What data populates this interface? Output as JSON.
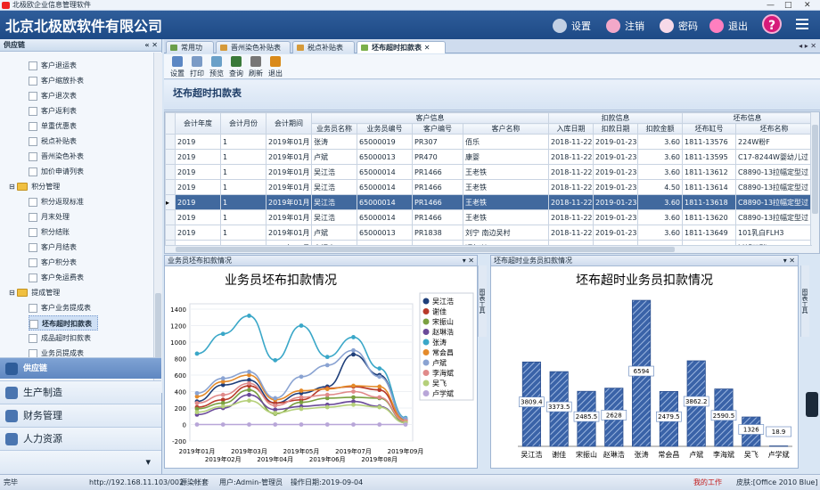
{
  "window": {
    "title": "北极欧企业信息管理软件",
    "controls": [
      "—",
      "□",
      "✕"
    ]
  },
  "header": {
    "app_title": "北京北极欧软件有限公司",
    "buttons": [
      {
        "label": "设置",
        "color": "#c2d0e4"
      },
      {
        "label": "注销",
        "color": "#f3a8c9"
      },
      {
        "label": "密码",
        "color": "#f7d9e8"
      },
      {
        "label": "退出",
        "color": "#ff7fbf"
      }
    ],
    "help": "?"
  },
  "sidebar": {
    "title": "供应链",
    "pin": "« ✕",
    "tree": [
      {
        "label": "客户退运表",
        "type": "leaf",
        "level": 2
      },
      {
        "label": "客户缩放扑表",
        "type": "leaf",
        "level": 2
      },
      {
        "label": "客户退次表",
        "type": "leaf",
        "level": 2
      },
      {
        "label": "客户返利表",
        "type": "leaf",
        "level": 2
      },
      {
        "label": "单重优惠表",
        "type": "leaf",
        "level": 2
      },
      {
        "label": "税点补贴表",
        "type": "leaf",
        "level": 2
      },
      {
        "label": "晋州染色补表",
        "type": "leaf",
        "level": 2
      },
      {
        "label": "加价申请列表",
        "type": "leaf",
        "level": 2
      },
      {
        "label": "积分管理",
        "type": "folder",
        "level": 1
      },
      {
        "label": "积分返现标准",
        "type": "leaf",
        "level": 2
      },
      {
        "label": "月末处理",
        "type": "leaf",
        "level": 2
      },
      {
        "label": "积分结账",
        "type": "leaf",
        "level": 2
      },
      {
        "label": "客户月结表",
        "type": "leaf",
        "level": 2
      },
      {
        "label": "客户积分表",
        "type": "leaf",
        "level": 2
      },
      {
        "label": "客户免运费表",
        "type": "leaf",
        "level": 2
      },
      {
        "label": "提成管理",
        "type": "folder",
        "level": 1
      },
      {
        "label": "客户业务提成表",
        "type": "leaf",
        "level": 2
      },
      {
        "label": "坯布超时扣款表",
        "type": "leaf",
        "level": 2,
        "selected": true
      },
      {
        "label": "成品超时扣款表",
        "type": "leaf",
        "level": 2
      },
      {
        "label": "业务员提成表",
        "type": "leaf",
        "level": 2
      }
    ],
    "groups": [
      {
        "label": "供应链",
        "active": true
      },
      {
        "label": "生产制造"
      },
      {
        "label": "财务管理"
      },
      {
        "label": "人力资源"
      }
    ],
    "more": "▾"
  },
  "tabs": [
    {
      "label": "常用功能"
    },
    {
      "label": "晋州染色补贴表"
    },
    {
      "label": "税点补贴表"
    },
    {
      "label": "坯布超时扣款表",
      "active": true,
      "close": "✕"
    }
  ],
  "tab_nav": "◂ ▸ ✕",
  "toolbar": [
    {
      "label": "设置",
      "color": "#5b87c4"
    },
    {
      "label": "打印",
      "color": "#7b9bc6"
    },
    {
      "label": "预览",
      "color": "#6aa0c8"
    },
    {
      "label": "查询",
      "color": "#3a7a3a"
    },
    {
      "label": "刷新",
      "color": "#777777"
    },
    {
      "label": "退出",
      "color": "#d98a1a"
    }
  ],
  "form_title": "坯布超时扣款表",
  "grid": {
    "group_headers": [
      "客户信息",
      "扣款信息",
      "坯布信息"
    ],
    "columns": [
      "会计年度",
      "会计月份",
      "会计期间",
      "业务员名称",
      "业务员编号",
      "客户编号",
      "客户名称",
      "入库日期",
      "扣款日期",
      "扣款金额",
      "坯布缸号",
      "坯布名称"
    ],
    "rows": [
      [
        "2019",
        "1",
        "2019年01月",
        "张涛",
        "65000019",
        "PR307",
        "佰乐",
        "2018-11-22",
        "2019-01-23",
        "3.60",
        "1811-13576",
        "224W粉F"
      ],
      [
        "2019",
        "1",
        "2019年01月",
        "卢斌",
        "65000013",
        "PR470",
        "康婴",
        "2018-11-22",
        "2019-01-23",
        "3.60",
        "1811-13595",
        "C17-8244W婴幼儿过"
      ],
      [
        "2019",
        "1",
        "2019年01月",
        "吴江浩",
        "65000014",
        "PR1466",
        "王老铁",
        "2018-11-22",
        "2019-01-23",
        "3.60",
        "1811-13612",
        "C8890-13拉幅定型过"
      ],
      [
        "2019",
        "1",
        "2019年01月",
        "吴江浩",
        "65000014",
        "PR1466",
        "王老铁",
        "2018-11-22",
        "2019-01-23",
        "4.50",
        "1811-13614",
        "C8890-13拉幅定型过"
      ],
      [
        "2019",
        "1",
        "2019年01月",
        "吴江浩",
        "65000014",
        "PR1466",
        "王老铁",
        "2018-11-22",
        "2019-01-23",
        "3.60",
        "1811-13618",
        "C8890-13拉幅定型过"
      ],
      [
        "2019",
        "1",
        "2019年01月",
        "吴江浩",
        "65000014",
        "PR1466",
        "王老铁",
        "2018-11-22",
        "2019-01-23",
        "3.60",
        "1811-13620",
        "C8890-13拉幅定型过"
      ],
      [
        "2019",
        "1",
        "2019年01月",
        "卢斌",
        "65000013",
        "PR1838",
        "刘宁 南边吴村",
        "2018-11-22",
        "2019-01-23",
        "3.60",
        "1811-13649",
        "101乳白FLH3"
      ],
      [
        "2019",
        "1",
        "2019年01月",
        "宋振山",
        "65000011",
        "PR1021",
        "顺尔兴",
        "2018-11-22",
        "2019-01-23",
        "3.60",
        "1811-13684",
        "过滤双碳K"
      ]
    ],
    "selected_row": 4,
    "current_marker": "▸"
  },
  "panels": {
    "left": {
      "title": "业务员坯布扣款情况",
      "dock": "图表工具",
      "ctl": "▾ ✕"
    },
    "right": {
      "title": "坯布超时业务员扣款情况",
      "dock": "图表工具",
      "ctl": "▾ ✕"
    }
  },
  "chart_data": [
    {
      "type": "line",
      "title": "业务员坯布扣款情况",
      "x": [
        "2019年01月",
        "2019年02月",
        "2019年03月",
        "2019年04月",
        "2019年05月",
        "2019年06月",
        "2019年07月",
        "2019年08月",
        "2019年09月"
      ],
      "ylim": [
        -200,
        1400
      ],
      "yticks": [
        -200,
        0,
        200,
        400,
        600,
        800,
        1000,
        1200,
        1400
      ],
      "legend": "right",
      "series": [
        {
          "name": "吴江浩",
          "color": "#1f3f7a",
          "values": [
            280,
            480,
            540,
            260,
            380,
            460,
            850,
            600,
            60
          ]
        },
        {
          "name": "谢佳",
          "color": "#b83a2a",
          "values": [
            210,
            300,
            470,
            260,
            300,
            440,
            460,
            420,
            40
          ]
        },
        {
          "name": "宋振山",
          "color": "#7aa040",
          "values": [
            190,
            260,
            420,
            130,
            270,
            320,
            330,
            320,
            30
          ]
        },
        {
          "name": "赵琳浩",
          "color": "#6a4a9a",
          "values": [
            120,
            200,
            360,
            180,
            220,
            240,
            280,
            220,
            20
          ]
        },
        {
          "name": "张涛",
          "color": "#3aa7c8",
          "values": [
            860,
            1100,
            1320,
            780,
            1200,
            820,
            1060,
            680,
            80
          ]
        },
        {
          "name": "常会昌",
          "color": "#e48a2a",
          "values": [
            340,
            520,
            600,
            300,
            410,
            430,
            470,
            460,
            50
          ]
        },
        {
          "name": "卢斌",
          "color": "#8aa3d2",
          "values": [
            380,
            560,
            640,
            320,
            580,
            720,
            900,
            580,
            70
          ]
        },
        {
          "name": "李海斌",
          "color": "#e08a8a",
          "values": [
            260,
            360,
            500,
            230,
            330,
            360,
            400,
            330,
            40
          ]
        },
        {
          "name": "吴飞",
          "color": "#b5d07a",
          "values": [
            150,
            220,
            290,
            140,
            190,
            210,
            240,
            210,
            20
          ]
        },
        {
          "name": "卢学斌",
          "color": "#b8a6d8",
          "values": [
            0,
            0,
            0,
            0,
            0,
            0,
            0,
            0,
            0
          ]
        }
      ]
    },
    {
      "type": "bar",
      "title": "坯布超时业务员扣款情况",
      "categories": [
        "吴江浩",
        "谢佳",
        "宋振山",
        "赵琳浩",
        "张涛",
        "常会昌",
        "卢斌",
        "李海斌",
        "吴飞",
        "卢学斌"
      ],
      "values": [
        3809.4,
        3373.5,
        2485.5,
        2628,
        6594,
        2479.5,
        3862.2,
        2590.5,
        1326,
        18.9
      ],
      "labels": [
        "3809.4",
        "3373.5",
        "2485.5",
        "2628",
        "6594",
        "2479.5",
        "3862.2",
        "2590.5",
        "1326",
        "18.9"
      ],
      "ylim": [
        0,
        7000
      ],
      "color": "#3a63a8"
    }
  ],
  "statusbar": {
    "state": "完毕",
    "url": "http://192.168.11.103/002",
    "account": "源染帐套",
    "user": "用户:Admin-管理员",
    "date": "操作日期:2019-09-04",
    "mywork": "我的工作",
    "skin": "皮肤:[Office 2010 Blue]"
  }
}
